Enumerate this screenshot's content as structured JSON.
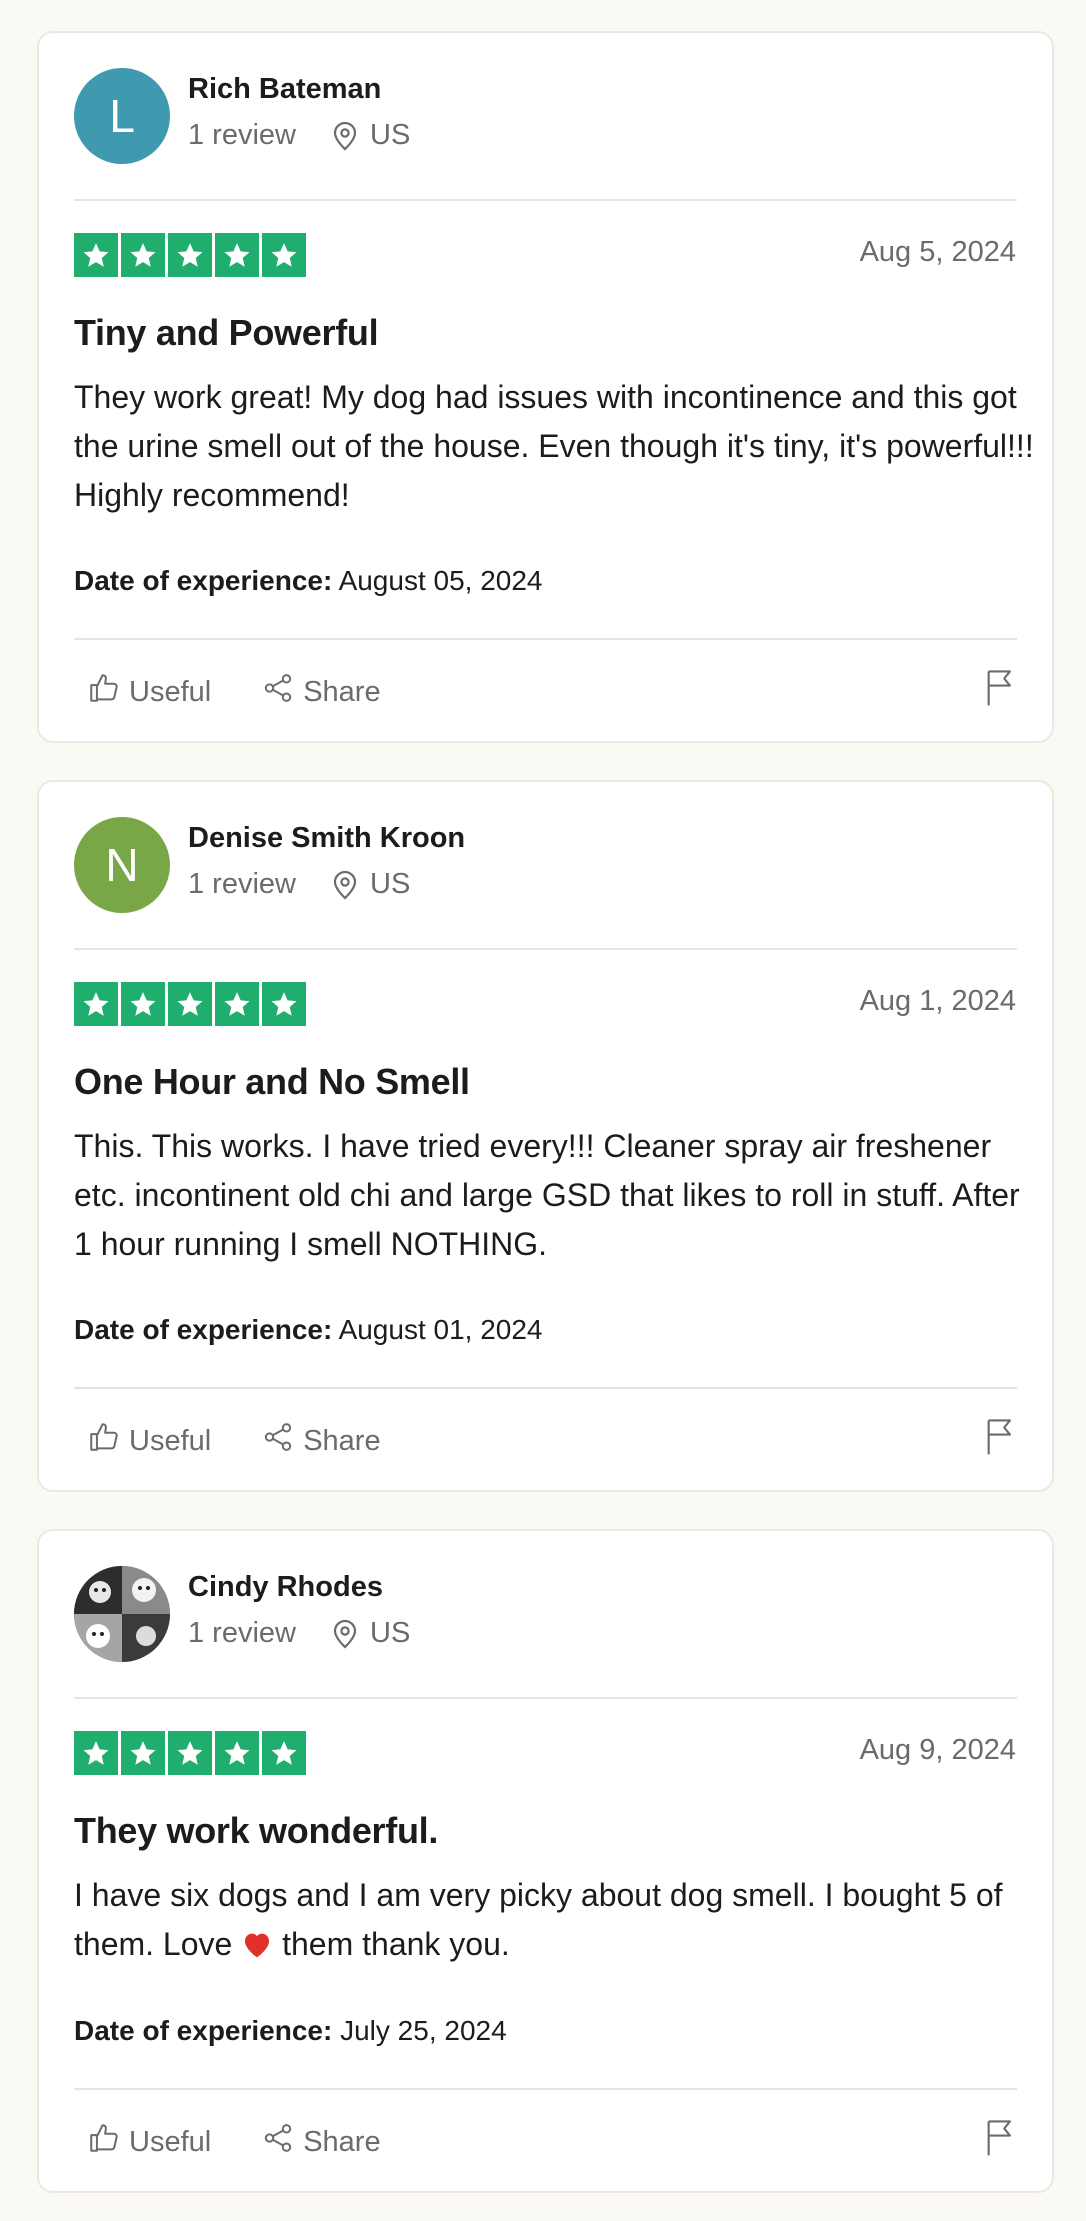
{
  "reviews": [
    {
      "avatar_initial": "L",
      "avatar_color": "#3f9ab0",
      "name": "Rich Bateman",
      "review_count": "1 review",
      "country": "US",
      "rating": 5,
      "date": "Aug 5, 2024",
      "title": "Tiny and Powerful",
      "body": "They work great! My dog had issues with incontinence and this got the urine smell out of the house. Even though it's tiny, it's powerful!!! Highly recommend!",
      "experience_label": "Date of experience:",
      "experience_date": "August 05, 2024",
      "useful_label": "Useful",
      "share_label": "Share"
    },
    {
      "avatar_initial": "N",
      "avatar_color": "#79a647",
      "name": "Denise Smith Kroon",
      "review_count": "1 review",
      "country": "US",
      "rating": 5,
      "date": "Aug 1, 2024",
      "title": "One Hour and No Smell",
      "body": "This. This works. I have tried every!!! Cleaner spray air freshener etc. incontinent old chi and large GSD that likes to roll in stuff. After 1 hour running I smell NOTHING.",
      "experience_label": "Date of experience:",
      "experience_date": "August 01, 2024",
      "useful_label": "Useful",
      "share_label": "Share"
    },
    {
      "avatar_initial": "",
      "avatar_color": "#555555",
      "name": "Cindy Rhodes",
      "review_count": "1 review",
      "country": "US",
      "rating": 5,
      "date": "Aug 9, 2024",
      "title": "They work wonderful.",
      "body_before": "I have six dogs and I am very picky about dog smell. I bought 5 of them. Love",
      "body_after": "them thank you.",
      "experience_label": "Date of experience:",
      "experience_date": "July 25, 2024",
      "useful_label": "Useful",
      "share_label": "Share"
    }
  ],
  "colors": {
    "star_green": "#1fae6e",
    "muted_text": "#6b6b6b",
    "heart_red": "#e0302a"
  }
}
